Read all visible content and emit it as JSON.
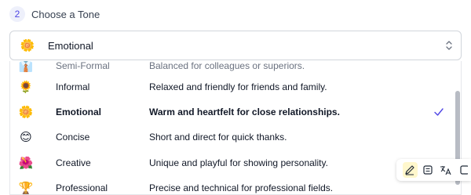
{
  "step": {
    "number": "2",
    "title": "Choose a Tone"
  },
  "select": {
    "emoji": "🌼",
    "value": "Emotional"
  },
  "options": [
    {
      "emoji": "👔",
      "name": "Semi-Formal",
      "desc": "Balanced for colleagues or superiors."
    },
    {
      "emoji": "🌻",
      "name": "Informal",
      "desc": "Relaxed and friendly for friends and family."
    },
    {
      "emoji": "🌼",
      "name": "Emotional",
      "desc": "Warm and heartfelt for close relationships.",
      "selected": true
    },
    {
      "emoji": "😊",
      "name": "Concise",
      "desc": "Short and direct for quick thanks."
    },
    {
      "emoji": "🌺",
      "name": "Creative",
      "desc": "Unique and playful for showing personality."
    },
    {
      "emoji": "🏆",
      "name": "Professional",
      "desc": "Precise and technical for professional fields."
    }
  ],
  "toolbar": {
    "icons": [
      "pencil-icon",
      "notes-icon",
      "translate-icon",
      "more-icon"
    ]
  }
}
